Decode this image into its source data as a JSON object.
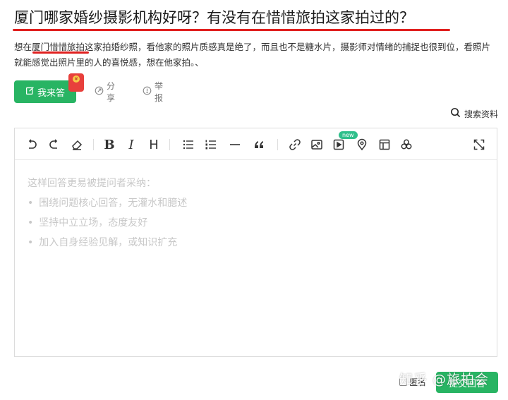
{
  "question": {
    "title": "厦门哪家婚纱摄影机构好呀？有没有在惜惜旅拍这家拍过的？",
    "description": "想在厦门惜惜旅拍这家拍婚纱照，看他家的照片质感真是绝了，而且也不是糖水片，摄影师对情绪的捕捉也很到位，看照片就能感觉出照片里的人的喜悦感，想在他家拍。、"
  },
  "actions": {
    "answer_label": "我来答",
    "share_label": "分享",
    "report_label": "举报",
    "redpacket_coin": "¥"
  },
  "search_doc_label": "搜索资料",
  "editor": {
    "new_badge": "new",
    "toolbar_bold": "B",
    "toolbar_italic": "I",
    "toolbar_heading": "H",
    "placeholder_title": "这样回答更易被提问者采纳：",
    "placeholder_tips": [
      "围绕问题核心回答，无灌水和臆述",
      "坚持中立立场，态度友好",
      "加入自身经验见解，或知识扩充"
    ]
  },
  "footer": {
    "anonymous_label": "匿名",
    "submit_label": "提交回答",
    "watermark": "知乎 @旅拍会"
  },
  "colors": {
    "accent_green": "#28b463",
    "underline_red": "#e0201f",
    "placeholder_gray": "#c8c8c8"
  }
}
